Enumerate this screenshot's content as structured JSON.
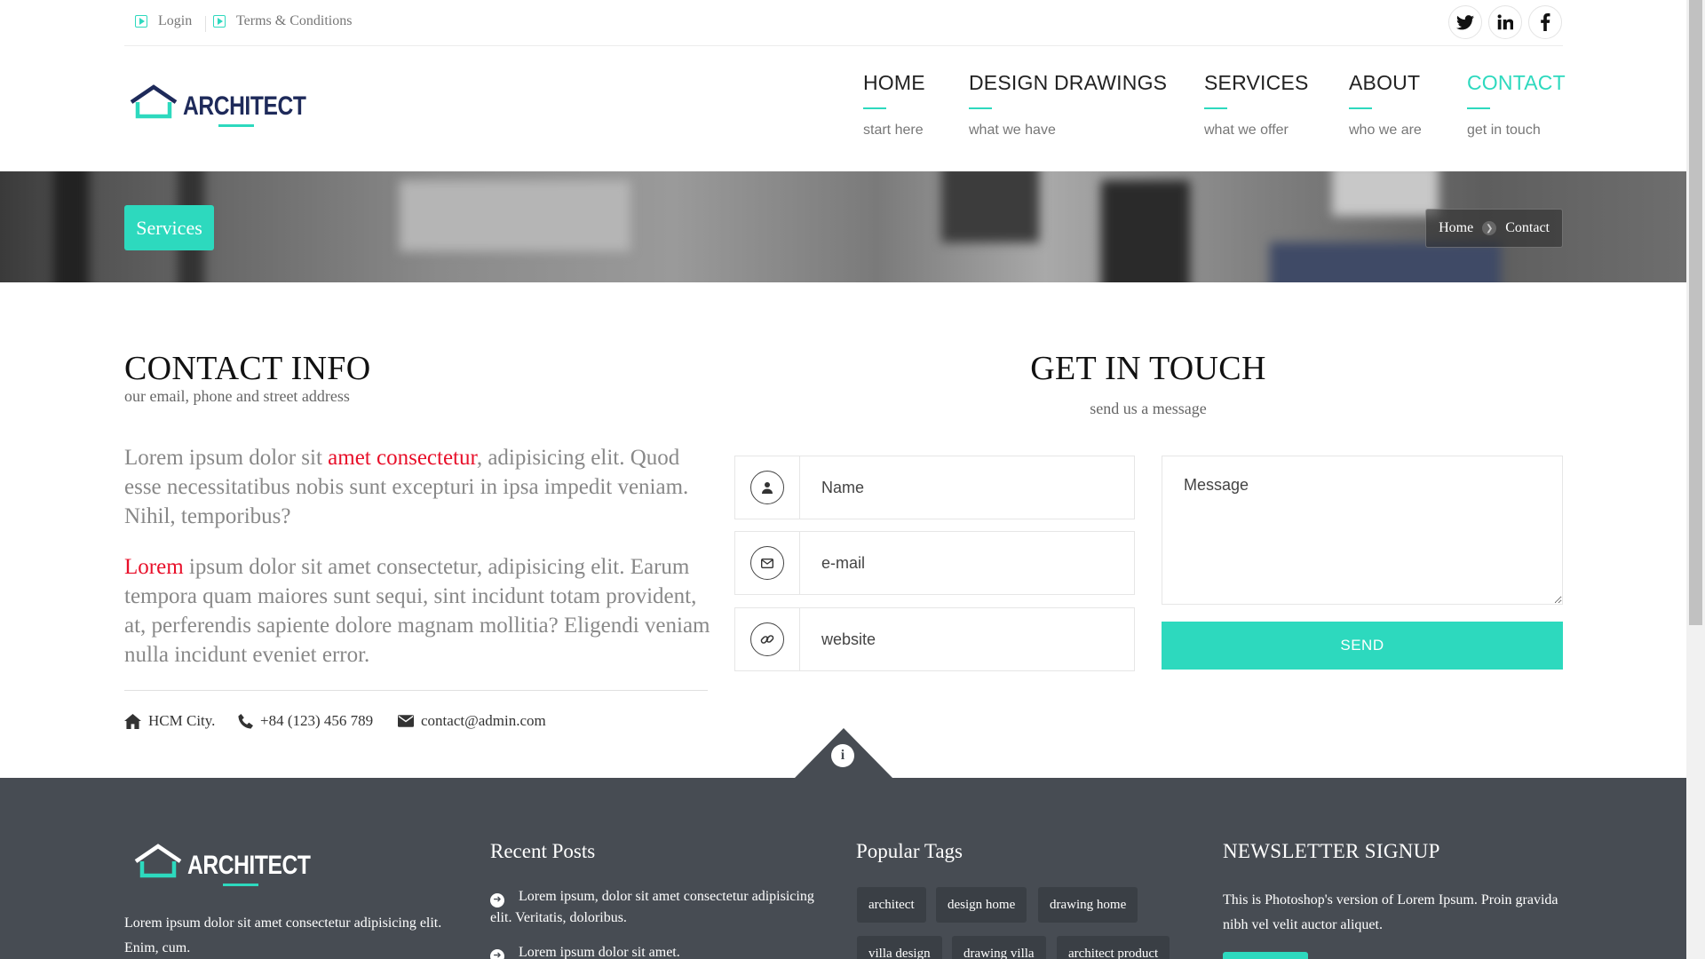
{
  "topbar": {
    "links": [
      {
        "label": "Login",
        "icon": "play-square-icon"
      },
      {
        "label": "Terms & Conditions",
        "icon": "play-square-icon"
      }
    ],
    "social": [
      {
        "icon": "twitter-icon"
      },
      {
        "icon": "linkedin-icon"
      },
      {
        "icon": "facebook-icon"
      }
    ]
  },
  "brand": {
    "name": "ARCHITECT",
    "accent": "#2dd9be",
    "navy": "#1e2a5a"
  },
  "nav": {
    "items": [
      {
        "title": "HOME",
        "sub": "start here"
      },
      {
        "title": "DESIGN DRAWINGS",
        "sub": "what we have"
      },
      {
        "title": "SERVICES",
        "sub": "what we offer"
      },
      {
        "title": "ABOUT",
        "sub": "who we are"
      },
      {
        "title": "CONTACT",
        "sub": "get in touch",
        "active": true
      }
    ]
  },
  "banner": {
    "button": "Services",
    "breadcrumb": [
      "Home",
      "Contact"
    ]
  },
  "contact_info": {
    "title": "CONTACT INFO",
    "subtitle": "our email, phone and street address",
    "para1_pre": "Lorem ipsum dolor sit ",
    "para1_red": "amet consectetur",
    "para1_post": ", adipisicing elit. Quod esse necessitatibus nobis sunt excepturi in ipsa impedit veniam. Nihil, temporibus?",
    "para2_red": "Lorem",
    "para2_post": " ipsum dolor sit amet consectetur, adipisicing elit. Earum tempora quam maiores sunt sequi, sint incidunt totam provident, at, perferendis sapiente dolore magnam mollitia? Eligendi veniam nulla incidunt eveniet error.",
    "address": "HCM City.",
    "phone": "+84 (123) 456 789",
    "email": "contact@admin.com"
  },
  "get_in_touch": {
    "title": "GET IN TOUCH",
    "subtitle": "send us a message",
    "name_placeholder": "Name",
    "email_placeholder": "e-mail",
    "website_placeholder": "website",
    "message_placeholder": "Message",
    "send_label": "SEND"
  },
  "footer": {
    "brand": "ARCHITECT",
    "about": "Lorem ipsum dolor sit amet consectetur adipisicing elit. Enim, cum.",
    "recent_posts_title": "Recent Posts",
    "posts": [
      "Lorem ipsum, dolor sit amet consectetur adipisicing elit. Veritatis, doloribus.",
      "Lorem ipsum dolor sit amet."
    ],
    "popular_tags_title": "Popular Tags",
    "tags": [
      "architect",
      "design home",
      "drawing home",
      "villa design",
      "drawing villa",
      "architect product"
    ],
    "newsletter_title": "NEWSLETTER SIGNUP",
    "newsletter_text": "This is Photoshop's version of Lorem Ipsum. Proin gravida nibh vel velit auctor aliquet."
  }
}
